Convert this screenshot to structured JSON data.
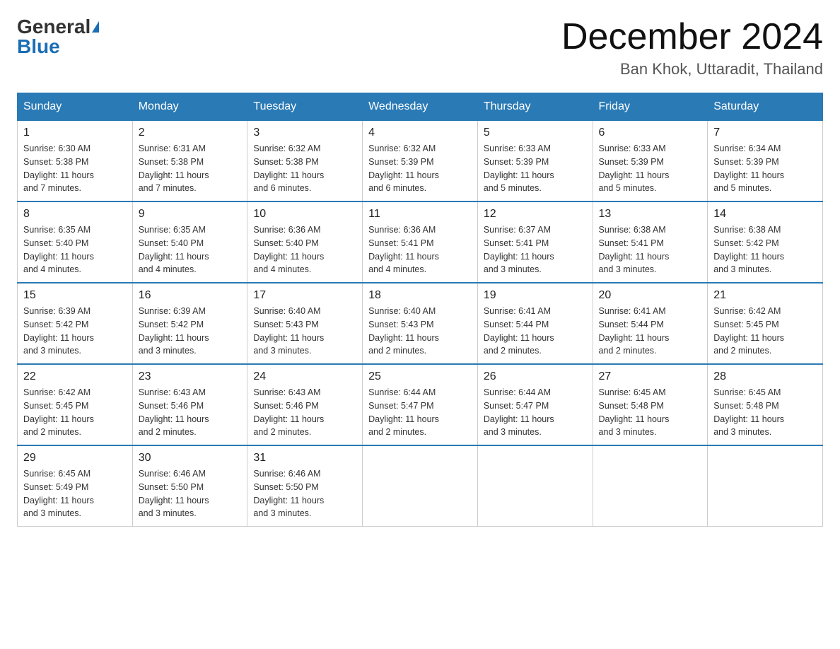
{
  "header": {
    "logo_general": "General",
    "logo_blue": "Blue",
    "month_title": "December 2024",
    "location": "Ban Khok, Uttaradit, Thailand"
  },
  "days_of_week": [
    "Sunday",
    "Monday",
    "Tuesday",
    "Wednesday",
    "Thursday",
    "Friday",
    "Saturday"
  ],
  "weeks": [
    [
      {
        "day": "1",
        "sunrise": "6:30 AM",
        "sunset": "5:38 PM",
        "daylight": "11 hours and 7 minutes."
      },
      {
        "day": "2",
        "sunrise": "6:31 AM",
        "sunset": "5:38 PM",
        "daylight": "11 hours and 7 minutes."
      },
      {
        "day": "3",
        "sunrise": "6:32 AM",
        "sunset": "5:38 PM",
        "daylight": "11 hours and 6 minutes."
      },
      {
        "day": "4",
        "sunrise": "6:32 AM",
        "sunset": "5:39 PM",
        "daylight": "11 hours and 6 minutes."
      },
      {
        "day": "5",
        "sunrise": "6:33 AM",
        "sunset": "5:39 PM",
        "daylight": "11 hours and 5 minutes."
      },
      {
        "day": "6",
        "sunrise": "6:33 AM",
        "sunset": "5:39 PM",
        "daylight": "11 hours and 5 minutes."
      },
      {
        "day": "7",
        "sunrise": "6:34 AM",
        "sunset": "5:39 PM",
        "daylight": "11 hours and 5 minutes."
      }
    ],
    [
      {
        "day": "8",
        "sunrise": "6:35 AM",
        "sunset": "5:40 PM",
        "daylight": "11 hours and 4 minutes."
      },
      {
        "day": "9",
        "sunrise": "6:35 AM",
        "sunset": "5:40 PM",
        "daylight": "11 hours and 4 minutes."
      },
      {
        "day": "10",
        "sunrise": "6:36 AM",
        "sunset": "5:40 PM",
        "daylight": "11 hours and 4 minutes."
      },
      {
        "day": "11",
        "sunrise": "6:36 AM",
        "sunset": "5:41 PM",
        "daylight": "11 hours and 4 minutes."
      },
      {
        "day": "12",
        "sunrise": "6:37 AM",
        "sunset": "5:41 PM",
        "daylight": "11 hours and 3 minutes."
      },
      {
        "day": "13",
        "sunrise": "6:38 AM",
        "sunset": "5:41 PM",
        "daylight": "11 hours and 3 minutes."
      },
      {
        "day": "14",
        "sunrise": "6:38 AM",
        "sunset": "5:42 PM",
        "daylight": "11 hours and 3 minutes."
      }
    ],
    [
      {
        "day": "15",
        "sunrise": "6:39 AM",
        "sunset": "5:42 PM",
        "daylight": "11 hours and 3 minutes."
      },
      {
        "day": "16",
        "sunrise": "6:39 AM",
        "sunset": "5:42 PM",
        "daylight": "11 hours and 3 minutes."
      },
      {
        "day": "17",
        "sunrise": "6:40 AM",
        "sunset": "5:43 PM",
        "daylight": "11 hours and 3 minutes."
      },
      {
        "day": "18",
        "sunrise": "6:40 AM",
        "sunset": "5:43 PM",
        "daylight": "11 hours and 2 minutes."
      },
      {
        "day": "19",
        "sunrise": "6:41 AM",
        "sunset": "5:44 PM",
        "daylight": "11 hours and 2 minutes."
      },
      {
        "day": "20",
        "sunrise": "6:41 AM",
        "sunset": "5:44 PM",
        "daylight": "11 hours and 2 minutes."
      },
      {
        "day": "21",
        "sunrise": "6:42 AM",
        "sunset": "5:45 PM",
        "daylight": "11 hours and 2 minutes."
      }
    ],
    [
      {
        "day": "22",
        "sunrise": "6:42 AM",
        "sunset": "5:45 PM",
        "daylight": "11 hours and 2 minutes."
      },
      {
        "day": "23",
        "sunrise": "6:43 AM",
        "sunset": "5:46 PM",
        "daylight": "11 hours and 2 minutes."
      },
      {
        "day": "24",
        "sunrise": "6:43 AM",
        "sunset": "5:46 PM",
        "daylight": "11 hours and 2 minutes."
      },
      {
        "day": "25",
        "sunrise": "6:44 AM",
        "sunset": "5:47 PM",
        "daylight": "11 hours and 2 minutes."
      },
      {
        "day": "26",
        "sunrise": "6:44 AM",
        "sunset": "5:47 PM",
        "daylight": "11 hours and 3 minutes."
      },
      {
        "day": "27",
        "sunrise": "6:45 AM",
        "sunset": "5:48 PM",
        "daylight": "11 hours and 3 minutes."
      },
      {
        "day": "28",
        "sunrise": "6:45 AM",
        "sunset": "5:48 PM",
        "daylight": "11 hours and 3 minutes."
      }
    ],
    [
      {
        "day": "29",
        "sunrise": "6:45 AM",
        "sunset": "5:49 PM",
        "daylight": "11 hours and 3 minutes."
      },
      {
        "day": "30",
        "sunrise": "6:46 AM",
        "sunset": "5:50 PM",
        "daylight": "11 hours and 3 minutes."
      },
      {
        "day": "31",
        "sunrise": "6:46 AM",
        "sunset": "5:50 PM",
        "daylight": "11 hours and 3 minutes."
      },
      null,
      null,
      null,
      null
    ]
  ],
  "labels": {
    "sunrise": "Sunrise:",
    "sunset": "Sunset:",
    "daylight": "Daylight:"
  }
}
